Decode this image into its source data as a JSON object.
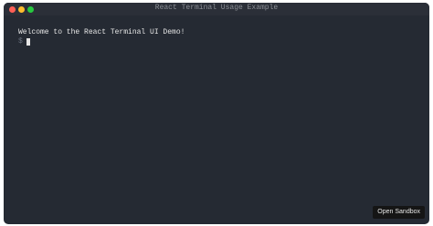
{
  "window": {
    "title": "React Terminal Usage Example"
  },
  "terminal": {
    "welcome": "Welcome to the React Terminal UI Demo!",
    "prompt": "$"
  },
  "actions": {
    "open_sandbox": "Open Sandbox"
  },
  "colors": {
    "background": "#252a33",
    "close": "#ff5f56",
    "minimize": "#ffbd2e",
    "maximize": "#27c93f"
  }
}
